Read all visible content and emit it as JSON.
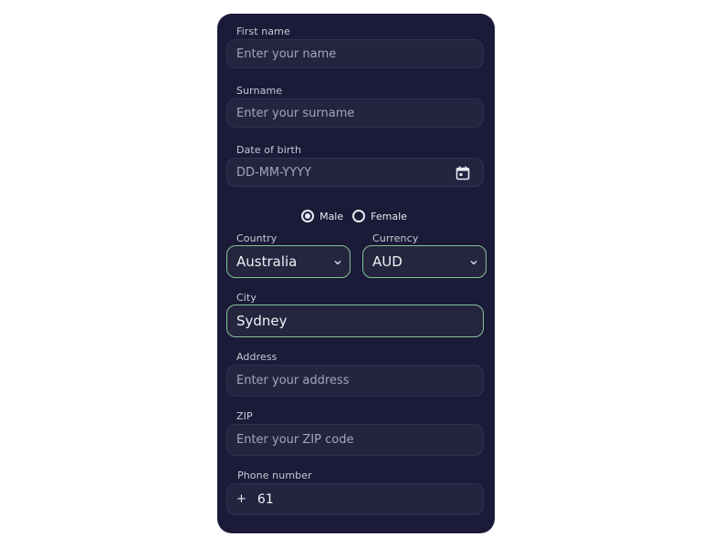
{
  "form": {
    "first_name": {
      "label": "First name",
      "placeholder": "Enter your name"
    },
    "surname": {
      "label": "Surname",
      "placeholder": "Enter your surname"
    },
    "dob": {
      "label": "Date of birth",
      "placeholder": "DD-MM-YYYY",
      "icon": "calendar-icon"
    },
    "gender": {
      "options": [
        "Male",
        "Female"
      ],
      "selected": "Male"
    },
    "country": {
      "label": "Country",
      "value": "Australia",
      "icon": "chevron-down-icon"
    },
    "currency": {
      "label": "Currency",
      "value": "AUD",
      "icon": "chevron-down-icon"
    },
    "city": {
      "label": "City",
      "value": "Sydney"
    },
    "address": {
      "label": "Address",
      "placeholder": "Enter your address"
    },
    "zip": {
      "label": "ZIP",
      "placeholder": "Enter your ZIP code"
    },
    "phone": {
      "label": "Phone number",
      "prefix": "+",
      "code": "61"
    }
  },
  "colors": {
    "card_bg": "#1b1a38",
    "field_bg": "#242441",
    "focus_border": "#86c39a",
    "text": "#f1f1f6",
    "placeholder": "#a4a4b8"
  }
}
